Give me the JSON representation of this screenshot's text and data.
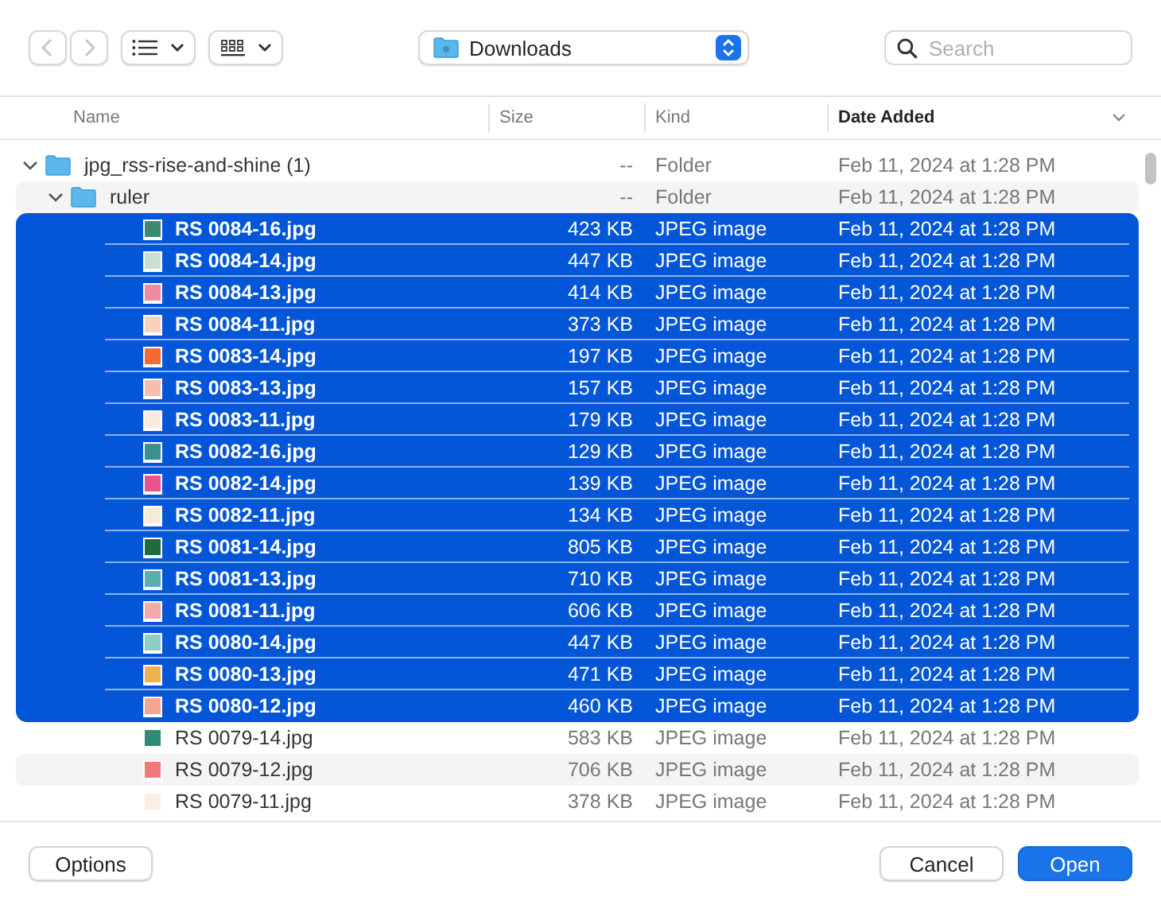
{
  "toolbar": {
    "location": "Downloads",
    "search": {
      "placeholder": "Search"
    }
  },
  "table": {
    "columns": [
      {
        "label": "Name",
        "sorted": false
      },
      {
        "label": "Size",
        "sorted": false
      },
      {
        "label": "Kind",
        "sorted": false
      },
      {
        "label": "Date Added",
        "sorted": true
      }
    ],
    "rows": [
      {
        "kind": "folder",
        "name": "jpg_rss-rise-and-shine (1)",
        "size": "--",
        "type": "Folder",
        "date": "Feb 11, 2024 at 1:28 PM",
        "expanded": true,
        "selected": false,
        "children": [
          {
            "kind": "folder",
            "name": "ruler",
            "size": "--",
            "type": "Folder",
            "date": "Feb 11, 2024 at 1:28 PM",
            "expanded": true,
            "selected": false,
            "children": [
              {
                "kind": "file",
                "name": "RS 0084-16.jpg",
                "size": "423 KB",
                "type": "JPEG image",
                "date": "Feb 11, 2024 at 1:28 PM",
                "selected": true,
                "color": "#3d8a72"
              },
              {
                "kind": "file",
                "name": "RS 0084-14.jpg",
                "size": "447 KB",
                "type": "JPEG image",
                "date": "Feb 11, 2024 at 1:28 PM",
                "selected": true,
                "color": "#c7e0d0"
              },
              {
                "kind": "file",
                "name": "RS 0084-13.jpg",
                "size": "414 KB",
                "type": "JPEG image",
                "date": "Feb 11, 2024 at 1:28 PM",
                "selected": true,
                "color": "#f08aa0"
              },
              {
                "kind": "file",
                "name": "RS 0084-11.jpg",
                "size": "373 KB",
                "type": "JPEG image",
                "date": "Feb 11, 2024 at 1:28 PM",
                "selected": true,
                "color": "#f7d2bd"
              },
              {
                "kind": "file",
                "name": "RS 0083-14.jpg",
                "size": "197 KB",
                "type": "JPEG image",
                "date": "Feb 11, 2024 at 1:28 PM",
                "selected": true,
                "color": "#f26a35"
              },
              {
                "kind": "file",
                "name": "RS 0083-13.jpg",
                "size": "157 KB",
                "type": "JPEG image",
                "date": "Feb 11, 2024 at 1:28 PM",
                "selected": true,
                "color": "#f5bfae"
              },
              {
                "kind": "file",
                "name": "RS 0083-11.jpg",
                "size": "179 KB",
                "type": "JPEG image",
                "date": "Feb 11, 2024 at 1:28 PM",
                "selected": true,
                "color": "#fbe9dc"
              },
              {
                "kind": "file",
                "name": "RS 0082-16.jpg",
                "size": "129 KB",
                "type": "JPEG image",
                "date": "Feb 11, 2024 at 1:28 PM",
                "selected": true,
                "color": "#3d9090"
              },
              {
                "kind": "file",
                "name": "RS 0082-14.jpg",
                "size": "139 KB",
                "type": "JPEG image",
                "date": "Feb 11, 2024 at 1:28 PM",
                "selected": true,
                "color": "#e8558a"
              },
              {
                "kind": "file",
                "name": "RS 0082-11.jpg",
                "size": "134 KB",
                "type": "JPEG image",
                "date": "Feb 11, 2024 at 1:28 PM",
                "selected": true,
                "color": "#f7ead8"
              },
              {
                "kind": "file",
                "name": "RS 0081-14.jpg",
                "size": "805 KB",
                "type": "JPEG image",
                "date": "Feb 11, 2024 at 1:28 PM",
                "selected": true,
                "color": "#1f6b3c"
              },
              {
                "kind": "file",
                "name": "RS 0081-13.jpg",
                "size": "710 KB",
                "type": "JPEG image",
                "date": "Feb 11, 2024 at 1:28 PM",
                "selected": true,
                "color": "#5ab0ad"
              },
              {
                "kind": "file",
                "name": "RS 0081-11.jpg",
                "size": "606 KB",
                "type": "JPEG image",
                "date": "Feb 11, 2024 at 1:28 PM",
                "selected": true,
                "color": "#f5a8aa"
              },
              {
                "kind": "file",
                "name": "RS 0080-14.jpg",
                "size": "447 KB",
                "type": "JPEG image",
                "date": "Feb 11, 2024 at 1:28 PM",
                "selected": true,
                "color": "#8ccfc5"
              },
              {
                "kind": "file",
                "name": "RS 0080-13.jpg",
                "size": "471 KB",
                "type": "JPEG image",
                "date": "Feb 11, 2024 at 1:28 PM",
                "selected": true,
                "color": "#f0b050"
              },
              {
                "kind": "file",
                "name": "RS 0080-12.jpg",
                "size": "460 KB",
                "type": "JPEG image",
                "date": "Feb 11, 2024 at 1:28 PM",
                "selected": true,
                "color": "#f5a590"
              },
              {
                "kind": "file",
                "name": "RS 0079-14.jpg",
                "size": "583 KB",
                "type": "JPEG image",
                "date": "Feb 11, 2024 at 1:28 PM",
                "selected": false,
                "color": "#2f8a78"
              },
              {
                "kind": "file",
                "name": "RS 0079-12.jpg",
                "size": "706 KB",
                "type": "JPEG image",
                "date": "Feb 11, 2024 at 1:28 PM",
                "selected": false,
                "color": "#f07a7a"
              },
              {
                "kind": "file",
                "name": "RS 0079-11.jpg",
                "size": "378 KB",
                "type": "JPEG image",
                "date": "Feb 11, 2024 at 1:28 PM",
                "selected": false,
                "color": "#faefe2"
              }
            ]
          }
        ]
      }
    ]
  },
  "buttons": [
    {
      "label": "Options",
      "kind": "secondary"
    },
    {
      "label": "Cancel",
      "kind": "secondary"
    },
    {
      "label": "Open",
      "kind": "primary"
    }
  ]
}
